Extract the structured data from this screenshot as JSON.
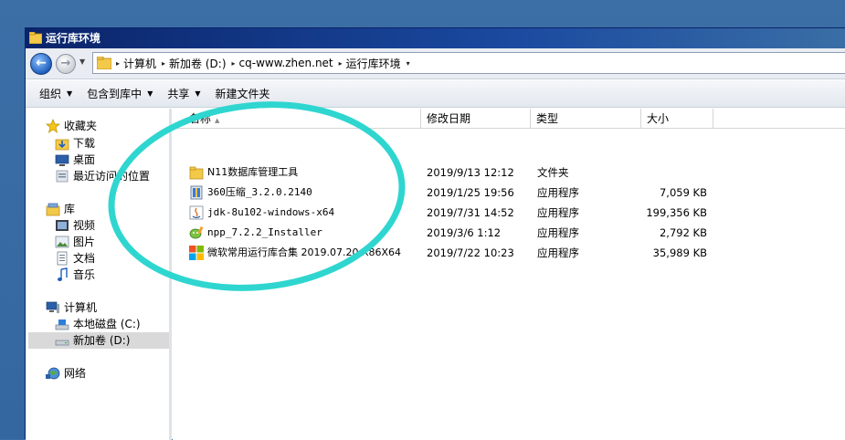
{
  "window": {
    "title": "运行库环境"
  },
  "address": {
    "crumbs": [
      "计算机",
      "新加卷 (D:)",
      "cq-www.zhen.net",
      "运行库环境"
    ]
  },
  "toolbar": {
    "organize": "组织",
    "include_in_library": "包含到库中",
    "share": "共享",
    "new_folder": "新建文件夹"
  },
  "navpane": {
    "favorites": "收藏夹",
    "downloads": "下载",
    "desktop": "桌面",
    "recent": "最近访问的位置",
    "libraries": "库",
    "videos": "视频",
    "pictures": "图片",
    "documents": "文档",
    "music": "音乐",
    "computer": "计算机",
    "local_disk": "本地磁盘 (C:)",
    "new_volume": "新加卷 (D:)",
    "network": "网络"
  },
  "columns": {
    "name": "名称",
    "modified": "修改日期",
    "type": "类型",
    "size": "大小"
  },
  "files": [
    {
      "name": "N11数据库管理工具",
      "modified": "2019/9/13 12:12",
      "type": "文件夹",
      "size": "",
      "icon": "folder-icon"
    },
    {
      "name": "360压缩_3.2.0.2140",
      "modified": "2019/1/25 19:56",
      "type": "应用程序",
      "size": "7,059 KB",
      "icon": "archive-app-icon"
    },
    {
      "name": "jdk-8u102-windows-x64",
      "modified": "2019/7/31 14:52",
      "type": "应用程序",
      "size": "199,356 KB",
      "icon": "java-icon"
    },
    {
      "name": "npp_7.2.2_Installer",
      "modified": "2019/3/6 1:12",
      "type": "应用程序",
      "size": "2,792 KB",
      "icon": "notepad-plus-icon"
    },
    {
      "name": "微软常用运行库合集 2019.07.20 X86X64",
      "modified": "2019/7/22 10:23",
      "type": "应用程序",
      "size": "35,989 KB",
      "icon": "windows-logo-icon"
    }
  ],
  "colors": {
    "annotation": "#2fd6d0",
    "titlebar": "#0a246a",
    "desktop": "#3a6ea5"
  }
}
